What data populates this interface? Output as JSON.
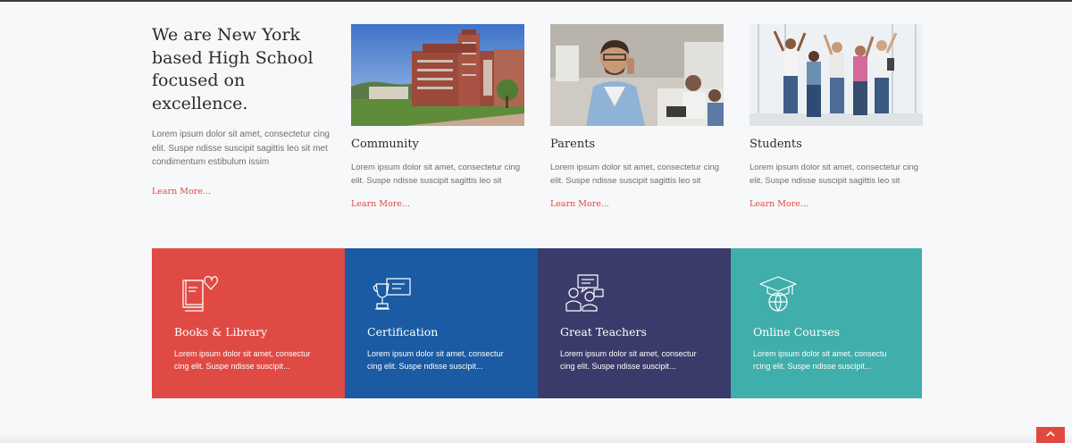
{
  "intro": {
    "heading": "We are New York based High School focused on excellence.",
    "body": "Lorem ipsum dolor sit amet, consectetur cing elit. Suspe ndisse suscipit sagittis leo sit met condimentum estibulum issim",
    "link": "Learn More..."
  },
  "cards": [
    {
      "title": "Community",
      "body": "Lorem ipsum dolor sit amet, consectetur cing elit. Suspe ndisse suscipit sagittis leo sit",
      "link": "Learn More..."
    },
    {
      "title": "Parents",
      "body": "Lorem ipsum dolor sit amet, consectetur cing elit. Suspe ndisse suscipit sagittis leo sit",
      "link": "Learn More..."
    },
    {
      "title": "Students",
      "body": "Lorem ipsum dolor sit amet, consectetur cing elit. Suspe ndisse suscipit sagittis leo sit",
      "link": "Learn More..."
    }
  ],
  "features": [
    {
      "title": "Books & Library",
      "body": "Lorem ipsum dolor sit amet, consectur cing elit. Suspe ndisse suscipit...",
      "icon": "book-heart-icon",
      "color": "#e04a44"
    },
    {
      "title": "Certification",
      "body": "Lorem ipsum dolor sit amet, consectur cing elit. Suspe ndisse suscipit...",
      "icon": "trophy-certificate-icon",
      "color": "#1a5ba3"
    },
    {
      "title": "Great Teachers",
      "body": "Lorem ipsum dolor sit amet, consectur cing elit. Suspe ndisse suscipit...",
      "icon": "teachers-chat-icon",
      "color": "#3b3b6b"
    },
    {
      "title": "Online Courses",
      "body": "Lorem ipsum dolor sit amet, consectu rcing elit. Suspe ndisse suscipit...",
      "icon": "graduation-globe-icon",
      "color": "#40aeaa"
    }
  ],
  "accent_color": "#e0493f",
  "scroll_top_icon": "chevron-up-icon"
}
